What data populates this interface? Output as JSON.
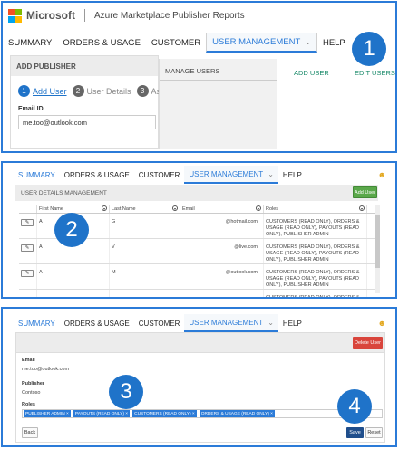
{
  "panel1": {
    "brand": "Microsoft",
    "app_title": "Azure Marketplace Publisher Reports",
    "nav": [
      "SUMMARY",
      "ORDERS & USAGE",
      "CUSTOMER",
      "USER MANAGEMENT",
      "HELP"
    ],
    "add_publisher_title": "ADD PUBLISHER",
    "steps": [
      {
        "num": "1",
        "label": "Add User"
      },
      {
        "num": "2",
        "label": "User Details"
      },
      {
        "num": "3",
        "label": "Ass"
      }
    ],
    "email_label": "Email ID",
    "email_value": "me.too@outlook.com",
    "manage_users": "MANAGE USERS",
    "add_user_link": "ADD USER",
    "edit_users_link": "EDIT USERS",
    "callout": "1"
  },
  "panel2": {
    "nav": [
      "SUMMARY",
      "ORDERS & USAGE",
      "CUSTOMER",
      "USER MANAGEMENT",
      "HELP"
    ],
    "section_title": "USER DETAILS MANAGEMENT",
    "add_user_button": "Add User",
    "columns": [
      "First Name",
      "Last Name",
      "Email",
      "Roles"
    ],
    "rows": [
      {
        "first": "A",
        "last": "G",
        "email": "@hotmail.com",
        "roles": "CUSTOMERS (READ ONLY), ORDERS & USAGE (READ ONLY), PAYOUTS (READ ONLY), PUBLISHER ADMIN"
      },
      {
        "first": "A",
        "last": "V",
        "email": "@live.com",
        "roles": "CUSTOMERS (READ ONLY), ORDERS & USAGE (READ ONLY), PAYOUTS (READ ONLY), PUBLISHER ADMIN"
      },
      {
        "first": "A",
        "last": "M",
        "email": "@outlook.com",
        "roles": "CUSTOMERS (READ ONLY), ORDERS & USAGE (READ ONLY), PAYOUTS (READ ONLY), PUBLISHER ADMIN"
      },
      {
        "first": "",
        "last": "",
        "email": "",
        "roles": "CUSTOMERS (READ ONLY), ORDERS & USAGE"
      }
    ],
    "callout": "2"
  },
  "panel3": {
    "nav": [
      "SUMMARY",
      "ORDERS & USAGE",
      "CUSTOMER",
      "USER MANAGEMENT",
      "HELP"
    ],
    "delete_button": "Delete User",
    "email_label": "Email",
    "email_value": "me.too@outlook.com",
    "publisher_label": "Publisher",
    "publisher_value": "Contoso",
    "roles_label": "Roles",
    "roles": [
      "PUBLISHER ADMIN",
      "PAYOUTS (READ ONLY)",
      "CUSTOMERS (READ ONLY)",
      "ORDERS & USAGE (READ ONLY)"
    ],
    "back_button": "Back",
    "save_button": "Save",
    "reset_button": "Reset",
    "callout3": "3",
    "callout4": "4"
  },
  "colors": {
    "accent": "#2b7bd8",
    "callout": "#1f73c9",
    "link_green": "#1a8a6a",
    "add_button": "#5aa84a",
    "delete_button": "#d9453c",
    "save_button": "#1f4e8c",
    "ms_logo": [
      "#f25022",
      "#7fba00",
      "#00a4ef",
      "#ffb900"
    ]
  }
}
